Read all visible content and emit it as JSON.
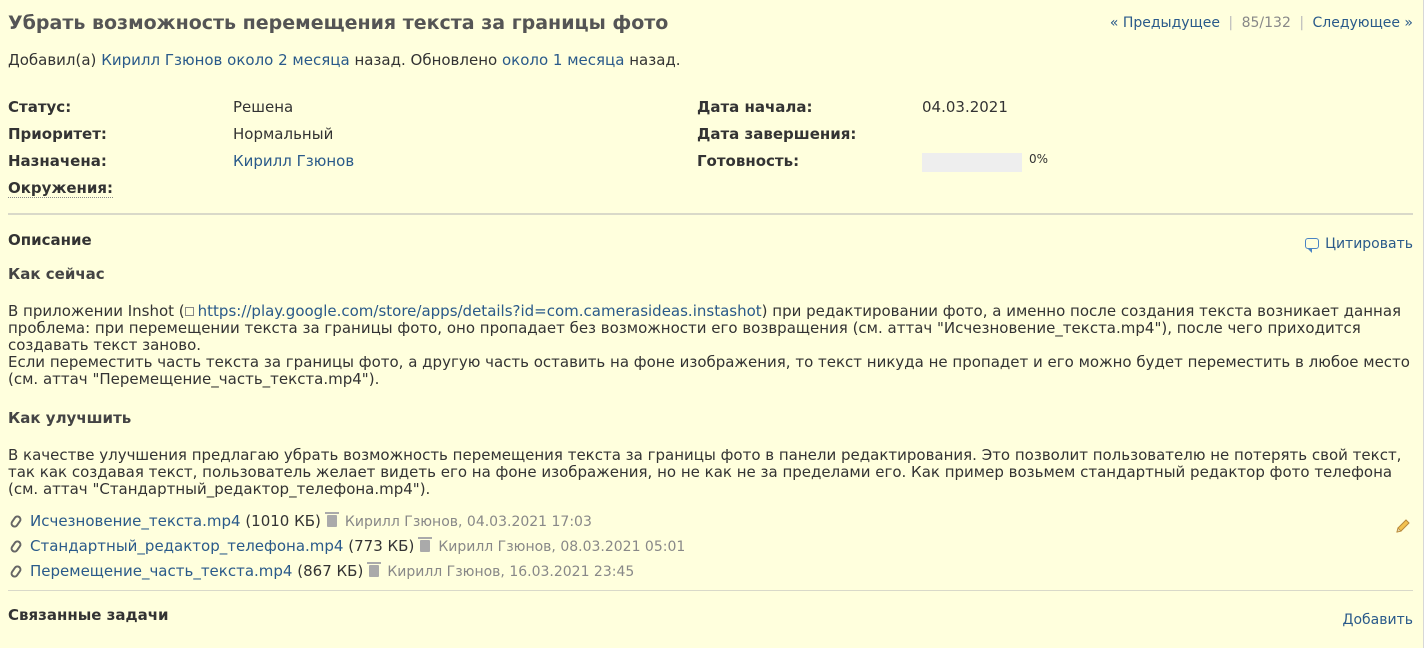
{
  "issue": {
    "title": "Убрать возможность перемещения текста за границы фото",
    "author_prefix": "Добавил(а)",
    "author": "Кирилл Гзюнов",
    "added_ago": "около 2 месяца",
    "added_suffix": "назад. Обновлено",
    "updated_ago": "около 1 месяца",
    "updated_suffix": "назад."
  },
  "nav": {
    "prev": "« Предыдущее",
    "counter": "85/132",
    "next": "Следующее »"
  },
  "attributes": {
    "status_label": "Статус:",
    "status_value": "Решена",
    "priority_label": "Приоритет:",
    "priority_value": "Нормальный",
    "assigned_label": "Назначена:",
    "assigned_value": "Кирилл Гзюнов",
    "env_label": "Окружения:",
    "start_label": "Дата начала:",
    "start_value": "04.03.2021",
    "due_label": "Дата завершения:",
    "done_label": "Готовность:",
    "done_value": "0%",
    "done_fraction": 0
  },
  "description": {
    "heading": "Описание",
    "quote_label": "Цитировать",
    "h_now": "Как сейчас",
    "p1_start": "В приложении Inshot (",
    "p1_link": "https://play.google.com/store/apps/details?id=com.camerasideas.instashot",
    "p1_end": ") при редактировании фото, а именно после создания текста возникает данная проблема: при перемещении текста за границы фото, оно пропадает без возможности его возвращения (см. аттач \"Исчезновение_текста.mp4\"), после чего приходится создавать текст заново.",
    "p1_line2": "Если переместить часть текста за границы фото, а другую часть оставить на фоне изображения, то текст никуда не пропадет и его можно будет переместить в любое место (см. аттач \"Перемещение_часть_текста.mp4\").",
    "h_improve": "Как улучшить",
    "p2": "В качестве улучшения предлагаю убрать возможность перемещения текста за границы фото в панели редактирования. Это позволит пользователю не потерять свой текст, так как создавая текст, пользователь желает видеть его на фоне изображения, но не как не за пределами его. Как пример возьмем стандартный редактор фото телефона (см. аттач \"Стандартный_редактор_телефона.mp4\")."
  },
  "attachments": [
    {
      "name": "Исчезновение_текста.mp4",
      "size": "(1010 КБ)",
      "meta": "Кирилл Гзюнов, 04.03.2021 17:03"
    },
    {
      "name": "Стандартный_редактор_телефона.mp4",
      "size": "(773 КБ)",
      "meta": "Кирилл Гзюнов, 08.03.2021 05:01"
    },
    {
      "name": "Перемещение_часть_текста.mp4",
      "size": "(867 КБ)",
      "meta": "Кирилл Гзюнов, 16.03.2021 23:45"
    }
  ],
  "related": {
    "heading": "Связанные задачи",
    "add_label": "Добавить"
  }
}
